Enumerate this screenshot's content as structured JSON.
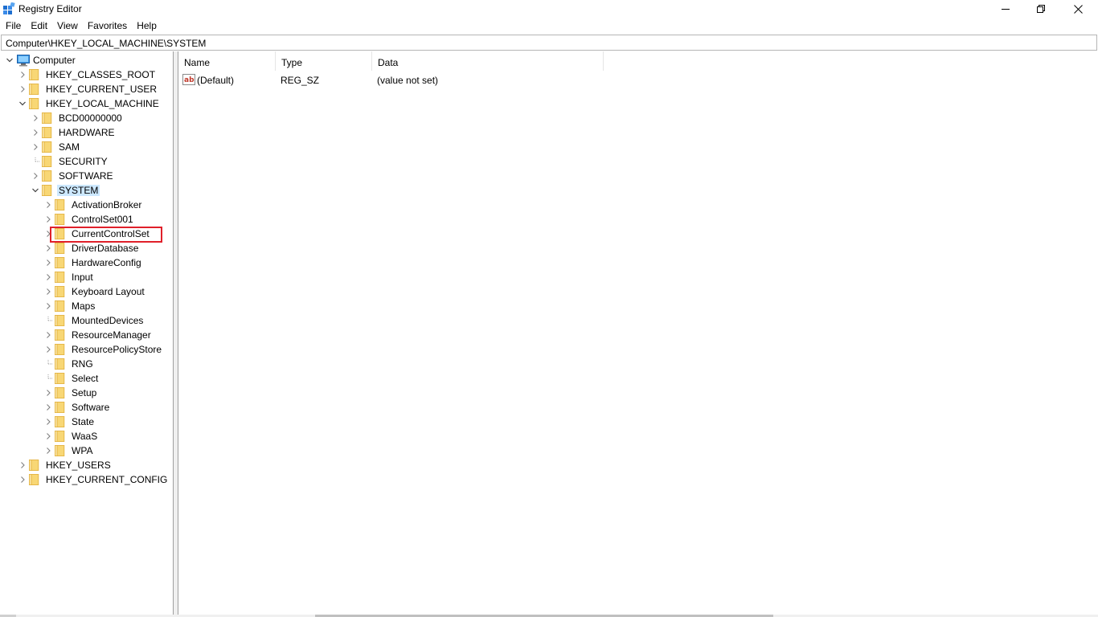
{
  "window": {
    "title": "Registry Editor"
  },
  "menu": [
    "File",
    "Edit",
    "View",
    "Favorites",
    "Help"
  ],
  "address": "Computer\\HKEY_LOCAL_MACHINE\\SYSTEM",
  "tree": [
    {
      "label": "Computer",
      "depth": 0,
      "expander": "expanded",
      "icon": "computer-icon"
    },
    {
      "label": "HKEY_CLASSES_ROOT",
      "depth": 1,
      "expander": "collapsed",
      "icon": "folder-icon"
    },
    {
      "label": "HKEY_CURRENT_USER",
      "depth": 1,
      "expander": "collapsed",
      "icon": "folder-icon"
    },
    {
      "label": "HKEY_LOCAL_MACHINE",
      "depth": 1,
      "expander": "expanded",
      "icon": "folder-icon"
    },
    {
      "label": "BCD00000000",
      "depth": 2,
      "expander": "collapsed",
      "icon": "folder-icon"
    },
    {
      "label": "HARDWARE",
      "depth": 2,
      "expander": "collapsed",
      "icon": "folder-icon"
    },
    {
      "label": "SAM",
      "depth": 2,
      "expander": "collapsed",
      "icon": "folder-icon"
    },
    {
      "label": "SECURITY",
      "depth": 2,
      "expander": "none",
      "icon": "folder-icon"
    },
    {
      "label": "SOFTWARE",
      "depth": 2,
      "expander": "collapsed",
      "icon": "folder-icon"
    },
    {
      "label": "SYSTEM",
      "depth": 2,
      "expander": "expanded",
      "icon": "folder-open-icon",
      "selected": true
    },
    {
      "label": "ActivationBroker",
      "depth": 3,
      "expander": "collapsed",
      "icon": "folder-icon"
    },
    {
      "label": "ControlSet001",
      "depth": 3,
      "expander": "collapsed",
      "icon": "folder-icon"
    },
    {
      "label": "CurrentControlSet",
      "depth": 3,
      "expander": "collapsed",
      "icon": "folder-icon",
      "highlighted": true
    },
    {
      "label": "DriverDatabase",
      "depth": 3,
      "expander": "collapsed",
      "icon": "folder-icon"
    },
    {
      "label": "HardwareConfig",
      "depth": 3,
      "expander": "collapsed",
      "icon": "folder-icon"
    },
    {
      "label": "Input",
      "depth": 3,
      "expander": "collapsed",
      "icon": "folder-icon"
    },
    {
      "label": "Keyboard Layout",
      "depth": 3,
      "expander": "collapsed",
      "icon": "folder-icon"
    },
    {
      "label": "Maps",
      "depth": 3,
      "expander": "collapsed",
      "icon": "folder-icon"
    },
    {
      "label": "MountedDevices",
      "depth": 3,
      "expander": "none",
      "icon": "folder-icon"
    },
    {
      "label": "ResourceManager",
      "depth": 3,
      "expander": "collapsed",
      "icon": "folder-icon"
    },
    {
      "label": "ResourcePolicyStore",
      "depth": 3,
      "expander": "collapsed",
      "icon": "folder-icon"
    },
    {
      "label": "RNG",
      "depth": 3,
      "expander": "none",
      "icon": "folder-icon"
    },
    {
      "label": "Select",
      "depth": 3,
      "expander": "none",
      "icon": "folder-icon"
    },
    {
      "label": "Setup",
      "depth": 3,
      "expander": "collapsed",
      "icon": "folder-icon"
    },
    {
      "label": "Software",
      "depth": 3,
      "expander": "collapsed",
      "icon": "folder-icon"
    },
    {
      "label": "State",
      "depth": 3,
      "expander": "collapsed",
      "icon": "folder-icon"
    },
    {
      "label": "WaaS",
      "depth": 3,
      "expander": "collapsed",
      "icon": "folder-icon"
    },
    {
      "label": "WPA",
      "depth": 3,
      "expander": "collapsed",
      "icon": "folder-icon"
    },
    {
      "label": "HKEY_USERS",
      "depth": 1,
      "expander": "collapsed",
      "icon": "folder-icon"
    },
    {
      "label": "HKEY_CURRENT_CONFIG",
      "depth": 1,
      "expander": "collapsed",
      "icon": "folder-icon"
    }
  ],
  "list": {
    "columns": [
      "Name",
      "Type",
      "Data"
    ],
    "rows": [
      {
        "name": "(Default)",
        "type": "REG_SZ",
        "data": "(value not set)",
        "icon": "string-value-icon"
      }
    ]
  },
  "colors": {
    "selection": "#cce8ff",
    "highlight_box": "#e0202a",
    "folder": "#f8d775",
    "folder_edge": "#e3b341"
  }
}
